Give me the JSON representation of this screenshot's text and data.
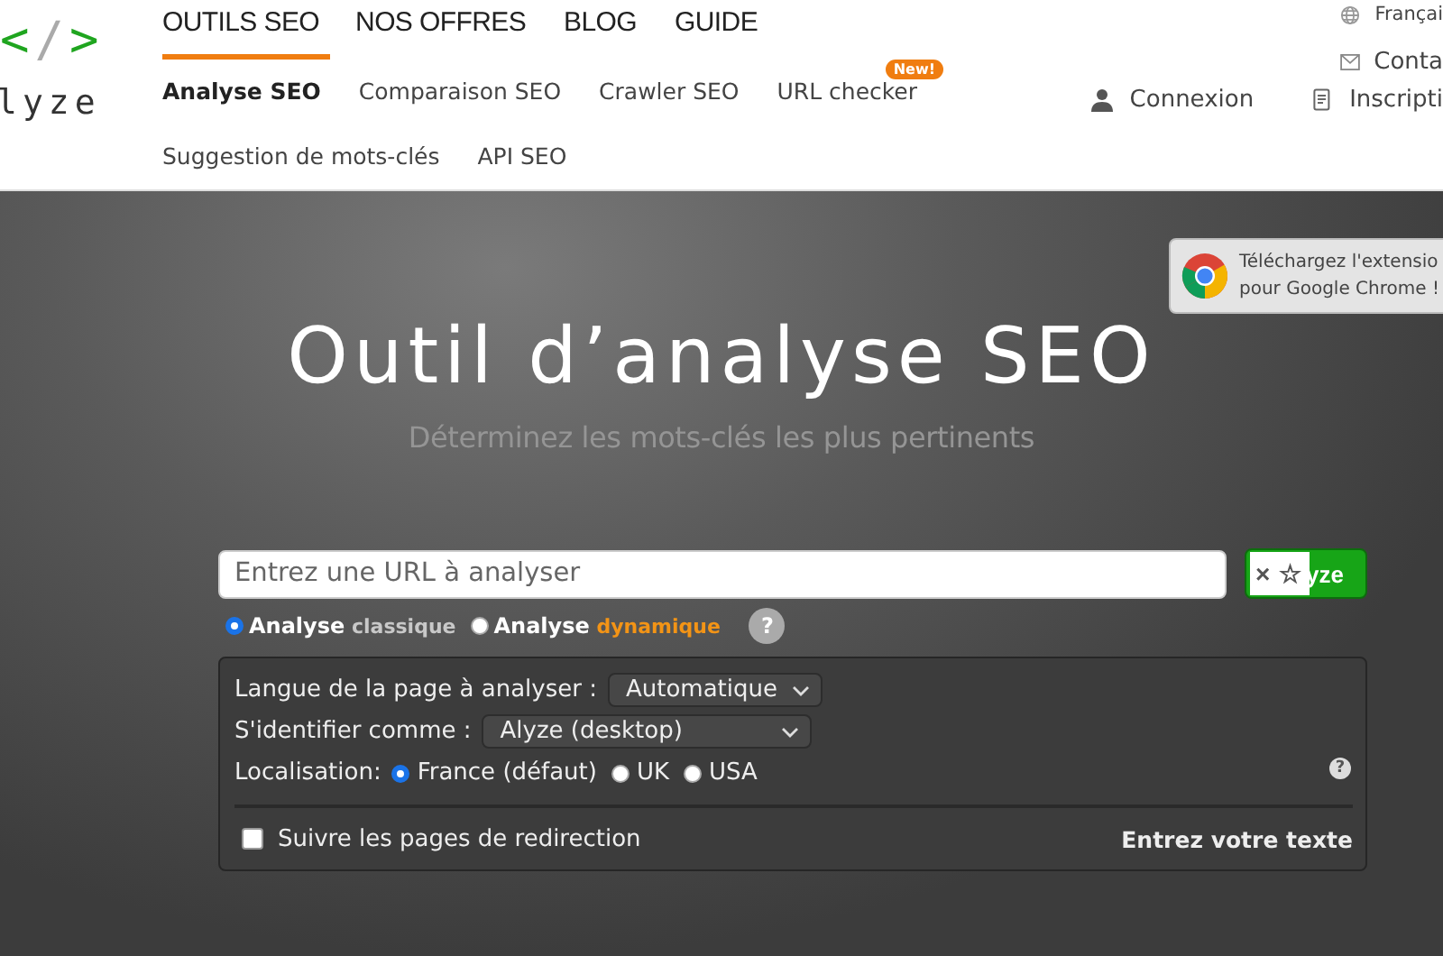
{
  "header": {
    "logo_mark": "</>",
    "logo_text": "lyze",
    "main_nav": [
      {
        "label": "OUTILS SEO",
        "selected": true
      },
      {
        "label": "NOS OFFRES",
        "selected": false
      },
      {
        "label": "BLOG",
        "selected": false
      },
      {
        "label": "GUIDE",
        "selected": false
      }
    ],
    "sub_nav": [
      {
        "label": "Analyse SEO",
        "selected": true
      },
      {
        "label": "Comparaison SEO",
        "selected": false
      },
      {
        "label": "Crawler SEO",
        "selected": false
      },
      {
        "label": "URL checker",
        "selected": false,
        "badge": "New!"
      },
      {
        "label": "Suggestion de mots-clés",
        "selected": false
      },
      {
        "label": "API SEO",
        "selected": false
      }
    ],
    "language": "Françai",
    "contact": "Conta",
    "login": "Connexion",
    "signup": "Inscripti"
  },
  "extension_banner": {
    "lines": [
      "Téléchargez l'extensio",
      "pour Google Chrome !"
    ]
  },
  "hero": {
    "title": "Outil d’analyse SEO",
    "subtitle": "Déterminez les mots-clés les plus pertinents"
  },
  "search": {
    "placeholder": "Entrez une URL à analyser",
    "button": "yze",
    "popup": [
      "×",
      "☆"
    ]
  },
  "modes": [
    {
      "label": "Analyse",
      "detail": "classique",
      "color": "#c8c8c8",
      "selected": true
    },
    {
      "label": "Analyse",
      "detail": "dynamique",
      "color": "#f39416",
      "selected": false
    }
  ],
  "mode_help": "?",
  "options": {
    "language": {
      "label": "Langue de la page à analyser :",
      "value": "Automatique"
    },
    "identity": {
      "label": "S'identifier comme :",
      "value": "Alyze (desktop)"
    },
    "location": {
      "label": "Localisation:",
      "choices": [
        {
          "label": "France (défaut)",
          "selected": true
        },
        {
          "label": "UK",
          "selected": false
        },
        {
          "label": "USA",
          "selected": false
        }
      ]
    },
    "help": "?",
    "follow_redirects": {
      "label": "Suivre les pages de redirection",
      "checked": false
    },
    "text_link": "Entrez votre texte"
  }
}
